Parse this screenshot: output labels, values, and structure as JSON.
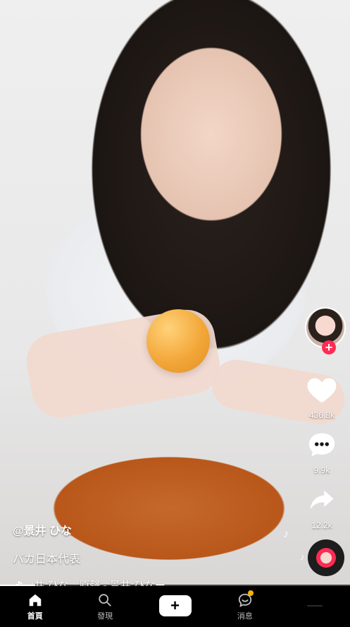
{
  "counts": {
    "likes": "436.8k",
    "comments": "9.9k",
    "shares": "12.2k"
  },
  "caption": {
    "username": "@景井 ひな",
    "description": "バカ日本代表",
    "music": ":井 ひな　原聲 - 景井 ひなー"
  },
  "nav": {
    "home": "首頁",
    "discover": "發現",
    "create": "+",
    "inbox": "消息"
  },
  "icons": {
    "like": "heart-icon",
    "comment": "comment-icon",
    "share": "share-icon",
    "music": "music-note-icon",
    "home": "home-icon",
    "discover": "search-icon",
    "inbox": "inbox-icon",
    "create": "plus-icon"
  },
  "colors": {
    "accent": "#fe2c55",
    "cyan": "#25f4ee",
    "badge": "#f6b300"
  }
}
